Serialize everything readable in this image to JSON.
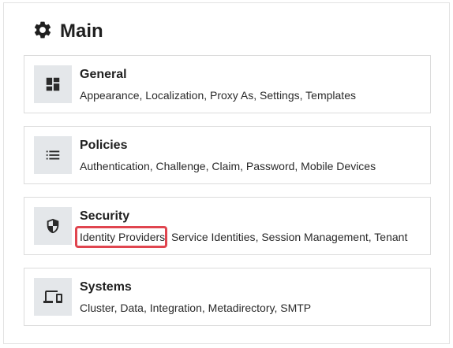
{
  "header": {
    "title": "Main",
    "icon": "gear-icon"
  },
  "cards": [
    {
      "title": "General",
      "icon": "dashboard-icon",
      "links": [
        "Appearance",
        "Localization",
        "Proxy As",
        "Settings",
        "Templates"
      ]
    },
    {
      "title": "Policies",
      "icon": "list-icon",
      "links": [
        "Authentication",
        "Challenge",
        "Claim",
        "Password",
        "Mobile Devices"
      ]
    },
    {
      "title": "Security",
      "icon": "shield-icon",
      "links": [
        "Identity Providers",
        "Service Identities",
        "Session Management",
        "Tenant"
      ]
    },
    {
      "title": "Systems",
      "icon": "devices-icon",
      "links": [
        "Cluster",
        "Data",
        "Integration",
        "Metadirectory",
        "SMTP"
      ]
    }
  ],
  "highlighted_link": "Identity Providers",
  "colors": {
    "highlight_border": "#e0454f",
    "icon_background": "#e4e7ea"
  }
}
